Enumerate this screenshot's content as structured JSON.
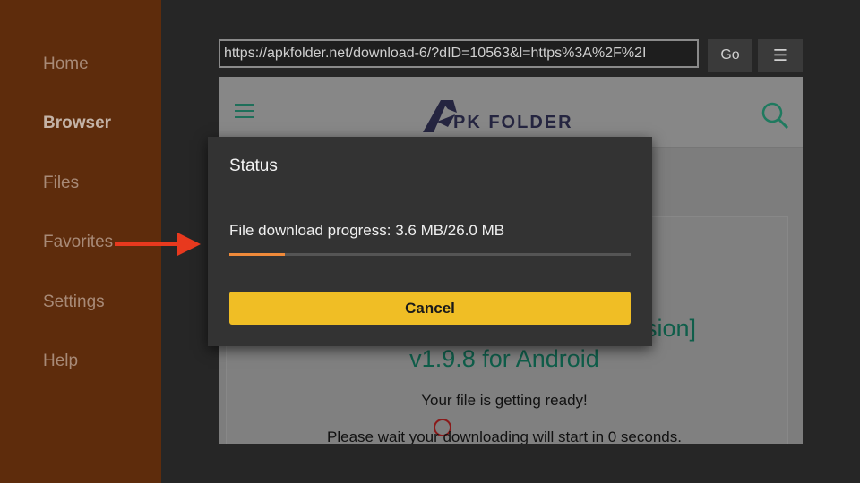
{
  "sidebar": {
    "items": [
      {
        "label": "Home"
      },
      {
        "label": "Browser"
      },
      {
        "label": "Files"
      },
      {
        "label": "Favorites"
      },
      {
        "label": "Settings"
      },
      {
        "label": "Help"
      }
    ],
    "active": "Browser",
    "background": "#5e2c0c"
  },
  "toolbar": {
    "url": "https://apkfolder.net/download-6/?dID=10563&l=https%3A%2F%2I",
    "go_label": "Go",
    "menu_icon": "hamburger-icon"
  },
  "webpage": {
    "logo_text": "PK FOLDER",
    "title_partial": "ersion]",
    "title_line2": "v1.9.8 for Android",
    "ready_text": "Your file is getting ready!",
    "wait_text": "Please wait your downloading will start in 0 seconds."
  },
  "dialog": {
    "title": "Status",
    "progress_text": "File download progress: 3.6 MB/26.0 MB",
    "progress_fraction": 0.138,
    "cancel_label": "Cancel",
    "accent": "#f0be25",
    "progress_color": "#f08a3a"
  },
  "annotation": {
    "arrow_color": "#e8391e"
  }
}
